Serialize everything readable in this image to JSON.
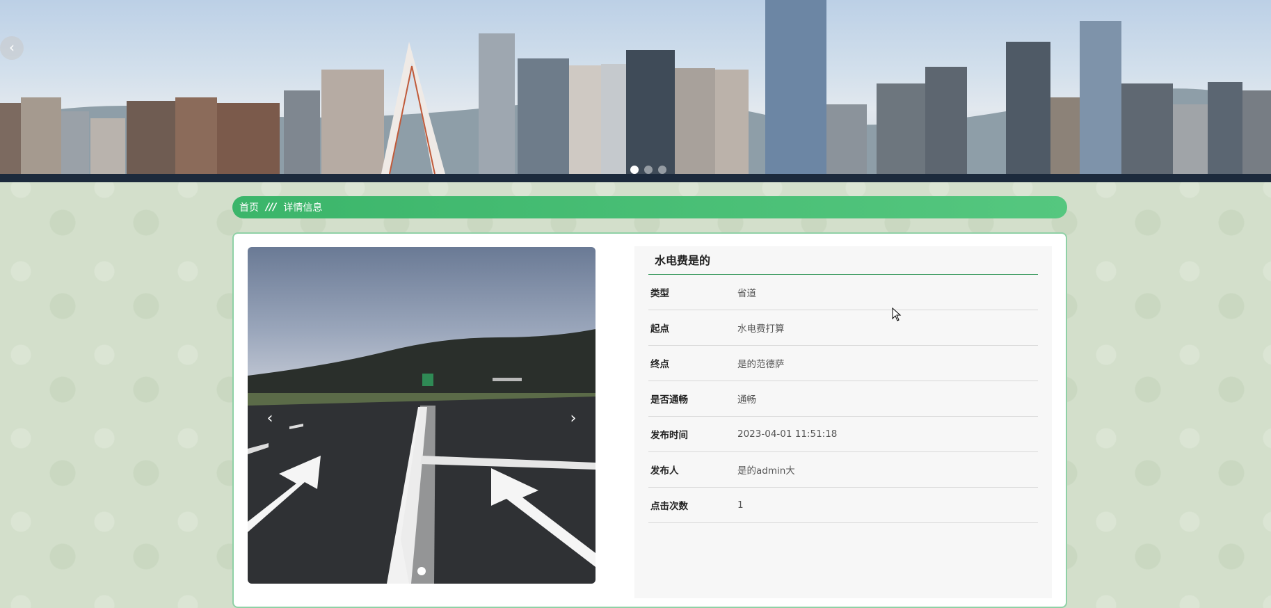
{
  "banner": {
    "prev_label": "‹",
    "slide_count": 3,
    "active_slide": 0
  },
  "breadcrumb": {
    "home": "首页",
    "separator": "///",
    "current": "详情信息"
  },
  "gallery": {
    "prev_label": "‹",
    "next_label": "›",
    "slide_count": 1
  },
  "detail": {
    "title": "水电费是的",
    "fields": [
      {
        "label": "类型",
        "value": "省道"
      },
      {
        "label": "起点",
        "value": "水电费打算"
      },
      {
        "label": "终点",
        "value": "是的范德萨"
      },
      {
        "label": "是否通畅",
        "value": "通畅"
      },
      {
        "label": "发布时间",
        "value": "2023-04-01 11:51:18"
      },
      {
        "label": "发布人",
        "value": "是的admin大"
      },
      {
        "label": "点击次数",
        "value": "1"
      }
    ]
  },
  "colors": {
    "accent": "#3bb56a",
    "background": "#d3dfcb",
    "title_rule": "#3a9a5f"
  }
}
